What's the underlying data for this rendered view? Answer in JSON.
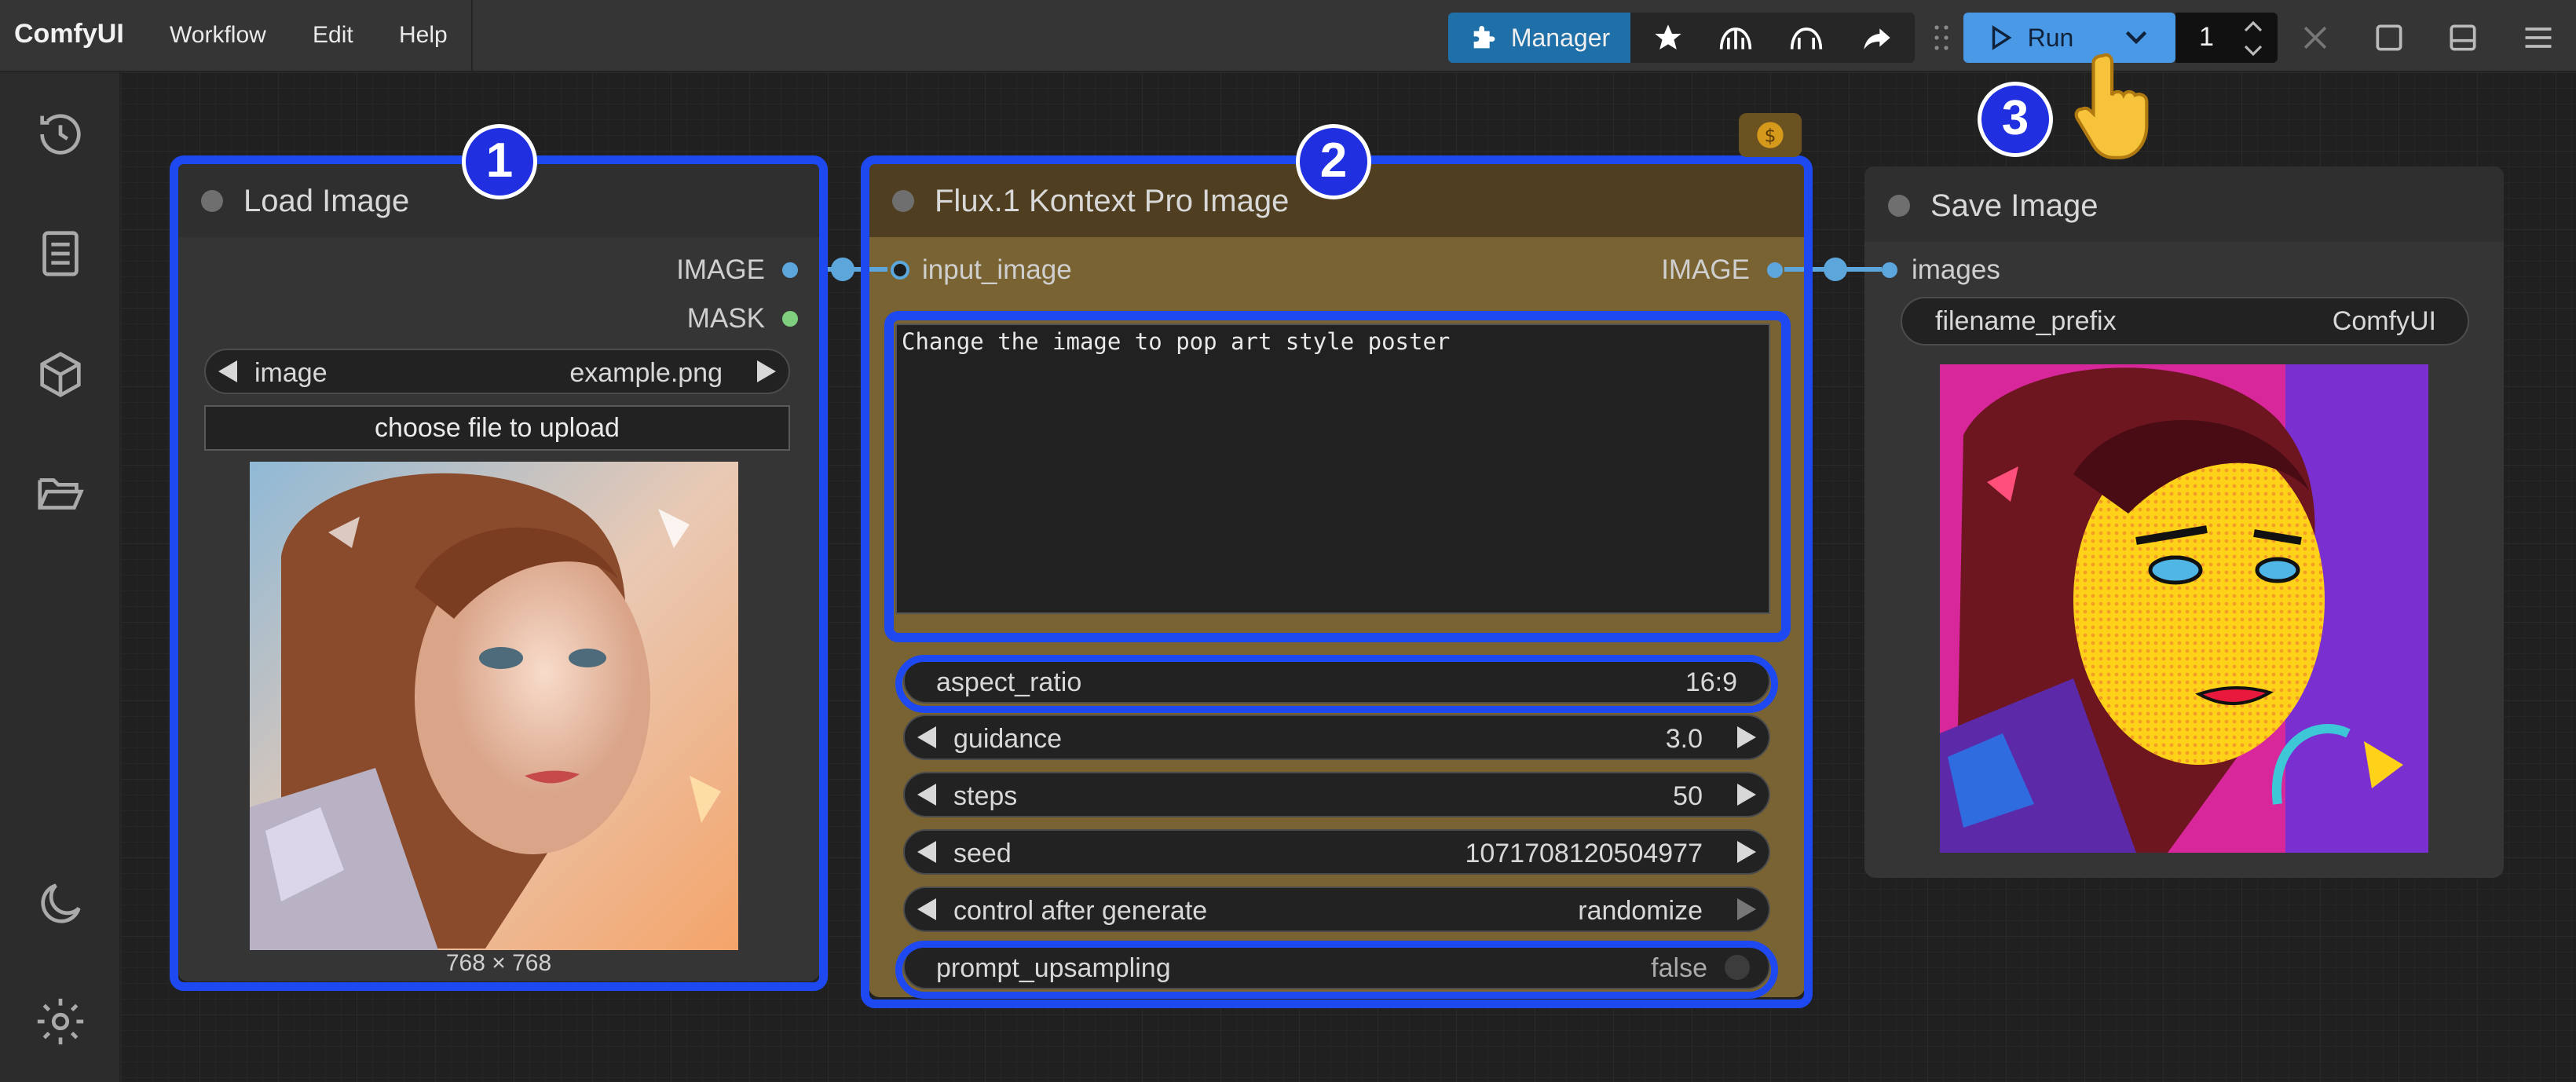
{
  "app": {
    "name": "ComfyUI"
  },
  "menu": {
    "workflow": "Workflow",
    "edit": "Edit",
    "help": "Help"
  },
  "toolbar": {
    "manager_label": "Manager",
    "run_label": "Run",
    "queue_count": "1"
  },
  "icons": [
    "puzzle-icon",
    "star-icon",
    "bridge-icon",
    "bridge-alt-icon",
    "share-icon",
    "drag-grip-icon",
    "play-icon",
    "chevron-down-icon",
    "increment-icon",
    "decrement-icon",
    "close-icon",
    "window-icon",
    "panel-icon",
    "hamburger-menu-icon",
    "history-icon",
    "document-icon",
    "cube-icon",
    "folder-open-icon",
    "moon-icon",
    "gear-icon",
    "coin-icon",
    "pointer-hand-icon"
  ],
  "colors": {
    "accent": "#4a99e6",
    "manager": "#1f6fa8",
    "highlight": "#1e49f0",
    "link": "#5ca6dc",
    "flux_node": "#7a6332"
  },
  "nodes": {
    "load_image": {
      "title": "Load Image",
      "outputs": [
        "IMAGE",
        "MASK"
      ],
      "image_widget": {
        "label": "image",
        "value": "example.png"
      },
      "upload_button": "choose file to upload",
      "preview_size": "768 × 768"
    },
    "flux": {
      "title": "Flux.1 Kontext Pro Image",
      "input": "input_image",
      "output": "IMAGE",
      "prompt": "Change the image to pop art style poster",
      "widgets": [
        {
          "label": "aspect_ratio",
          "value": "16:9"
        },
        {
          "label": "guidance",
          "value": "3.0"
        },
        {
          "label": "steps",
          "value": "50"
        },
        {
          "label": "seed",
          "value": "1071708120504977"
        },
        {
          "label": "control after generate",
          "value": "randomize"
        },
        {
          "label": "prompt_upsampling",
          "value": "false"
        }
      ]
    },
    "save_image": {
      "title": "Save Image",
      "input": "images",
      "filename_prefix": {
        "label": "filename_prefix",
        "value": "ComfyUI"
      }
    }
  },
  "badges": [
    "1",
    "2",
    "3"
  ]
}
